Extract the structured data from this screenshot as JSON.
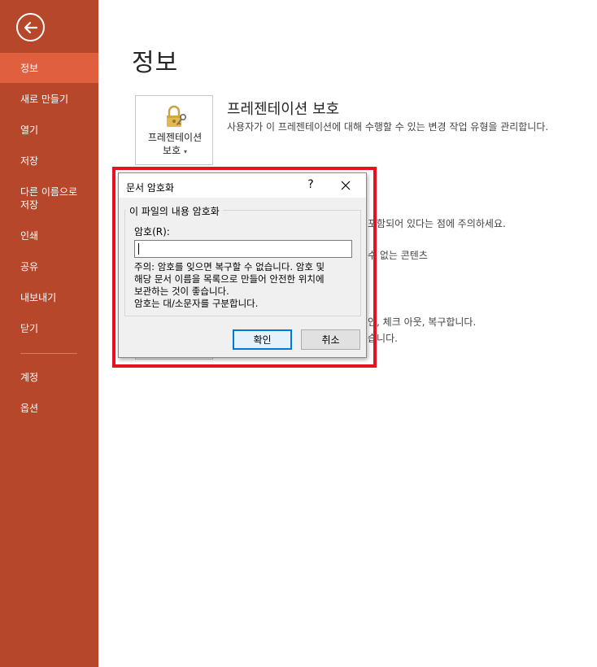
{
  "sidebar": {
    "items": [
      {
        "label": "정보",
        "active": true
      },
      {
        "label": "새로 만들기"
      },
      {
        "label": "열기"
      },
      {
        "label": "저장"
      },
      {
        "label": "다른 이름으로 저장"
      },
      {
        "label": "인쇄"
      },
      {
        "label": "공유"
      },
      {
        "label": "내보내기"
      },
      {
        "label": "닫기"
      },
      {
        "label": "계정"
      },
      {
        "label": "옵션"
      }
    ]
  },
  "main": {
    "title": "정보",
    "protect": {
      "tile_label_line1": "프레젠테이션",
      "tile_label_line2": "보호",
      "heading": "프레젠테이션 보호",
      "description": "사용자가 이 프레젠테이션에 대해 수행할 수 있는 변경 작업 유형을 관리합니다."
    },
    "partial_texts": {
      "t1": "포함되어 있다는 점에 주의하세요.",
      "t2": "수 없는 콘텐츠",
      "t3": "인, 체크 아웃, 복구합니다.",
      "t4": "습니다."
    }
  },
  "dialog": {
    "title": "문서 암호화",
    "help": "?",
    "group_label": "이 파일의 내용 암호화",
    "password_label": "암호(R):",
    "password_value": "",
    "notice_lines": [
      "주의: 암호를 잊으면 복구할 수 없습니다. 암호 및",
      "해당 문서 이름을 목록으로 만들어 안전한 위치에",
      "보관하는 것이 좋습니다.",
      "암호는 대/소문자를 구분합니다."
    ],
    "ok_label": "확인",
    "cancel_label": "취소"
  },
  "colors": {
    "sidebar_bg": "#b7472a",
    "sidebar_active": "#e05f3f",
    "highlight": "#e81123",
    "ok_border": "#0078d7"
  }
}
